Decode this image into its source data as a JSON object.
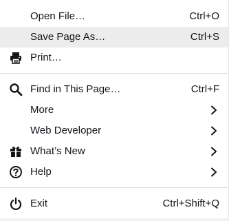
{
  "menu": {
    "items": [
      {
        "label": "Open File…",
        "shortcut": "Ctrl+O",
        "icon": "none"
      },
      {
        "label": "Save Page As…",
        "shortcut": "Ctrl+S",
        "icon": "none",
        "state": "hovered"
      },
      {
        "label": "Print…",
        "shortcut": "",
        "icon": "printer-icon"
      },
      {
        "label": "Find in This Page…",
        "shortcut": "Ctrl+F",
        "icon": "search-icon"
      },
      {
        "label": "More",
        "shortcut": "",
        "icon": "none",
        "submenu": true
      },
      {
        "label": "Web Developer",
        "shortcut": "",
        "icon": "none",
        "submenu": true
      },
      {
        "label": "What’s New",
        "shortcut": "",
        "icon": "gift-icon",
        "submenu": true
      },
      {
        "label": "Help",
        "shortcut": "",
        "icon": "help-icon",
        "submenu": true
      },
      {
        "label": "Exit",
        "shortcut": "Ctrl+Shift+Q",
        "icon": "power-icon"
      }
    ]
  },
  "colors": {
    "text": "#15141a",
    "hover_bg": "#ececec",
    "separator": "#dcdcde",
    "background": "#ffffff"
  }
}
